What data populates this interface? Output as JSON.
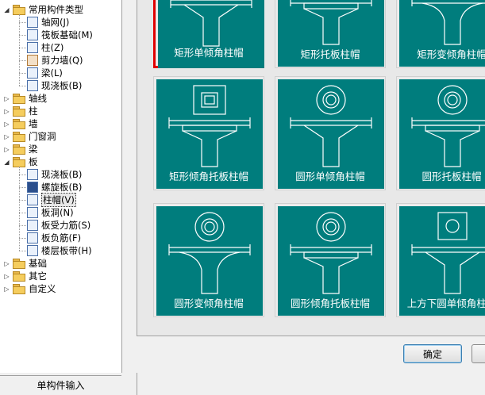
{
  "tree": {
    "items": [
      {
        "label": "常用构件类型",
        "level": 0,
        "kind": "folder",
        "expanded": true
      },
      {
        "label": "轴网(J)",
        "level": 1,
        "kind": "leaf",
        "icon": "grid-icon"
      },
      {
        "label": "筏板基础(M)",
        "level": 1,
        "kind": "leaf",
        "icon": "raft-foundation-icon"
      },
      {
        "label": "柱(Z)",
        "level": 1,
        "kind": "leaf",
        "icon": "column-icon"
      },
      {
        "label": "剪力墙(Q)",
        "level": 1,
        "kind": "leaf",
        "icon": "shear-wall-icon"
      },
      {
        "label": "梁(L)",
        "level": 1,
        "kind": "leaf",
        "icon": "beam-icon"
      },
      {
        "label": "现浇板(B)",
        "level": 1,
        "kind": "leaf",
        "icon": "slab-icon"
      },
      {
        "label": "轴线",
        "level": 0,
        "kind": "folder",
        "expanded": false
      },
      {
        "label": "柱",
        "level": 0,
        "kind": "folder",
        "expanded": false
      },
      {
        "label": "墙",
        "level": 0,
        "kind": "folder",
        "expanded": false
      },
      {
        "label": "门窗洞",
        "level": 0,
        "kind": "folder",
        "expanded": false
      },
      {
        "label": "梁",
        "level": 0,
        "kind": "folder",
        "expanded": false
      },
      {
        "label": "板",
        "level": 0,
        "kind": "folder",
        "expanded": true
      },
      {
        "label": "现浇板(B)",
        "level": 1,
        "kind": "leaf",
        "icon": "slab-icon"
      },
      {
        "label": "螺旋板(B)",
        "level": 1,
        "kind": "leaf",
        "icon": "spiral-slab-icon"
      },
      {
        "label": "柱帽(V)",
        "level": 1,
        "kind": "leaf",
        "icon": "column-cap-icon",
        "selected": true
      },
      {
        "label": "板洞(N)",
        "level": 1,
        "kind": "leaf",
        "icon": "slab-hole-icon"
      },
      {
        "label": "板受力筋(S)",
        "level": 1,
        "kind": "leaf",
        "icon": "slab-rebar-icon"
      },
      {
        "label": "板负筋(F)",
        "level": 1,
        "kind": "leaf",
        "icon": "negative-rebar-icon"
      },
      {
        "label": "楼层板带(H)",
        "level": 1,
        "kind": "leaf",
        "icon": "slab-band-icon"
      },
      {
        "label": "基础",
        "level": 0,
        "kind": "folder",
        "expanded": false
      },
      {
        "label": "其它",
        "level": 0,
        "kind": "folder",
        "expanded": false
      },
      {
        "label": "自定义",
        "level": 0,
        "kind": "folder",
        "expanded": false
      }
    ],
    "single_input_label": "单构件输入"
  },
  "thumbnails": {
    "tiles": [
      {
        "caption": "矩形单倾角柱帽",
        "shape": "rect-single-slope",
        "selected": true
      },
      {
        "caption": "矩形托板柱帽",
        "shape": "rect-plate"
      },
      {
        "caption": "矩形变倾角柱帽",
        "shape": "rect-variable-slope"
      },
      {
        "caption": "矩形倾角托板柱帽",
        "shape": "rect-slope-plate"
      },
      {
        "caption": "圆形单倾角柱帽",
        "shape": "round-single-slope"
      },
      {
        "caption": "圆形托板柱帽",
        "shape": "round-plate"
      },
      {
        "caption": "圆形变倾角柱帽",
        "shape": "round-variable-slope"
      },
      {
        "caption": "圆形倾角托板柱帽",
        "shape": "round-slope-plate"
      },
      {
        "caption": "上方下圆单倾角柱帽",
        "shape": "square-top-round-bottom"
      }
    ],
    "tile_color": "#007d7d"
  },
  "buttons": {
    "ok_label": "确定"
  },
  "colors": {
    "selection_border": "#e00000",
    "tile_background": "#007d7d"
  }
}
